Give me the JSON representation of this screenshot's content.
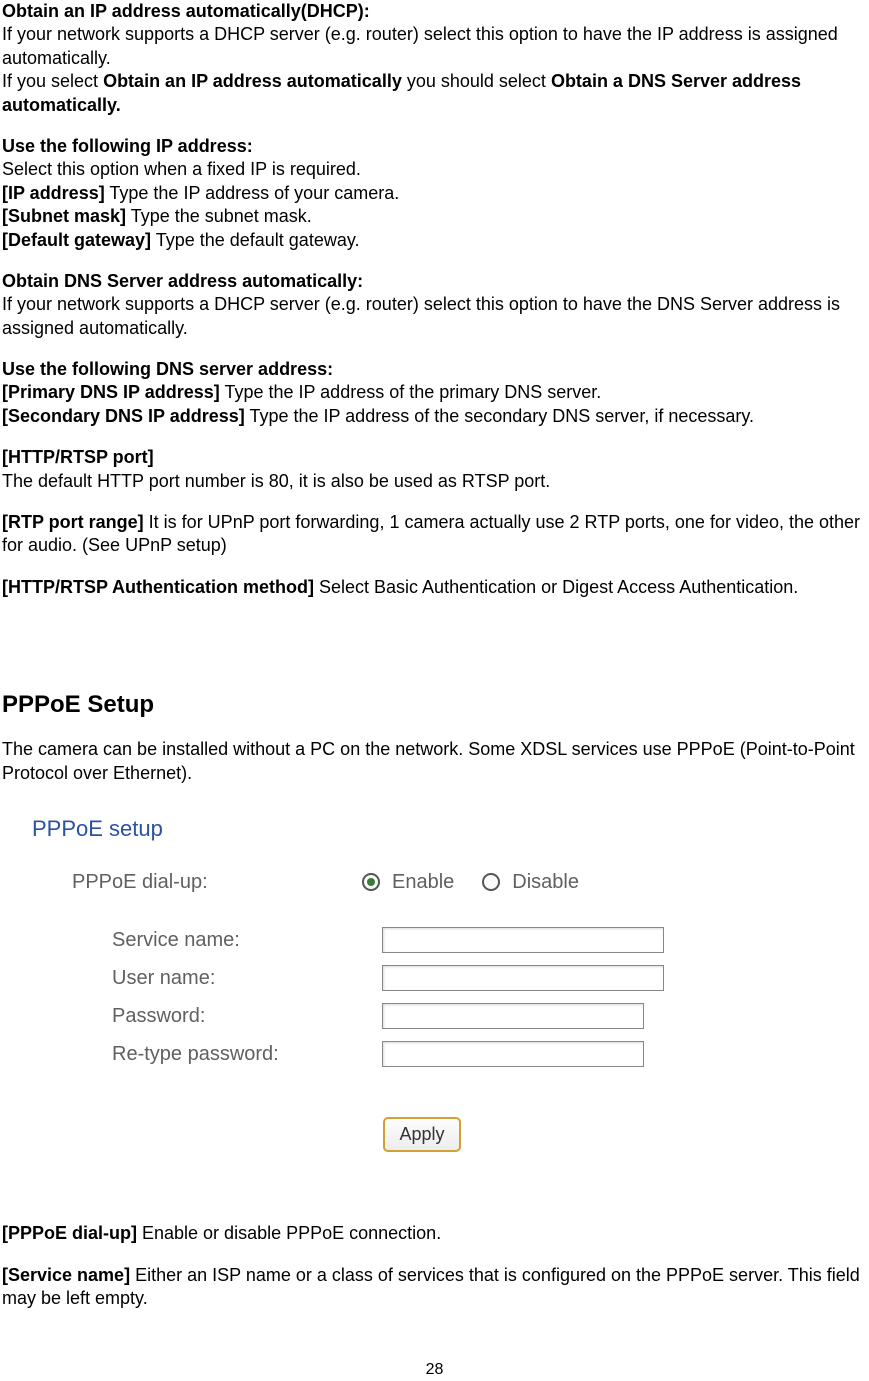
{
  "sections": {
    "dhcp": {
      "heading": "Obtain an IP address automatically(DHCP):",
      "line1": "If your network supports a DHCP server (e.g. router) select this option to have the IP address is assigned automatically.",
      "line2_prefix": "If you select ",
      "line2_bold1": "Obtain an IP address automatically",
      "line2_mid": " you should select ",
      "line2_bold2": "Obtain a DNS Server address automatically."
    },
    "static_ip": {
      "heading": "Use the following IP address:",
      "line1": "Select this option when a fixed IP is required.",
      "ip_label": "[IP address]",
      "ip_text": " Type the IP address of your camera.",
      "subnet_label": "[Subnet mask]",
      "subnet_text": " Type the subnet mask.",
      "gw_label": "[Default gateway]",
      "gw_text": " Type the default gateway."
    },
    "dns_auto": {
      "heading": "Obtain DNS Server address automatically:",
      "line1": "If your network supports a DHCP server (e.g. router) select this option to have the DNS Server address is assigned automatically."
    },
    "dns_static": {
      "heading": "Use the following DNS server address:",
      "primary_label": "[Primary DNS IP address]",
      "primary_text": " Type the IP address of the primary DNS server.",
      "secondary_label": "[Secondary DNS IP address]",
      "secondary_text": " Type the IP address of the secondary DNS server, if necessary."
    },
    "http_port": {
      "heading": "[HTTP/RTSP port]",
      "line1": "The default HTTP port number is 80, it is also be used as RTSP port."
    },
    "rtp": {
      "label": "[RTP port range]",
      "text": " It is for UPnP port forwarding, 1 camera actually use 2 RTP ports, one for video, the other for audio. (See UPnP setup)"
    },
    "auth": {
      "label": "[HTTP/RTSP Authentication method]",
      "text": " Select Basic Authentication or Digest Access Authentication."
    }
  },
  "pppoe": {
    "title": "PPPoE Setup",
    "intro": "The camera can be installed without a PC on the network. Some XDSL services use PPPoE (Point-to-Point Protocol over Ethernet).",
    "form": {
      "panel_title": "PPPoE setup",
      "dialup_label": "PPPoE dial-up:",
      "enable": "Enable",
      "disable": "Disable",
      "service_label": "Service name:",
      "user_label": "User name:",
      "password_label": "Password:",
      "retype_label": "Re-type password:",
      "apply": "Apply"
    },
    "dialup_field_label": "[PPPoE dial-up]",
    "dialup_field_text": " Enable or disable PPPoE connection.",
    "service_field_label": "[Service name]",
    "service_field_text": " Either an ISP name or a class of services that is configured on the PPPoE server. This field may be left empty."
  },
  "page_number": "28"
}
